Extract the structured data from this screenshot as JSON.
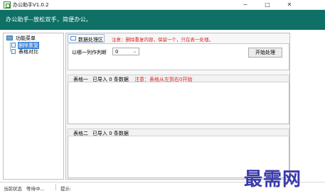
{
  "window": {
    "title": "办公助手V1.0.2",
    "minimize_glyph": "─",
    "maximize_glyph": "□",
    "close_glyph": "✕"
  },
  "banner": {
    "text": "办公助手--放松双手，简便办公。"
  },
  "sidebar": {
    "root_label": "功能菜单",
    "items": [
      {
        "label": "删除重复",
        "selected": true
      },
      {
        "label": "表格对比",
        "selected": false
      }
    ]
  },
  "main": {
    "tab_label": "数据处理区",
    "note": "注意：删除重复内容，保留一个，只在表一处理。",
    "sheet_label": "以哪一列作判断",
    "select_value": "0",
    "select_chevron": "⌄",
    "start_button": "开始处理"
  },
  "table1": {
    "name": "表格一",
    "count": "已导入 0 条数据",
    "note": "注意：表格从左到右0开始"
  },
  "table2": {
    "name": "表格二",
    "count": "已导入 0 条数据"
  },
  "status": {
    "state": "当前状态",
    "value": "等待中...",
    "hint": "提示:"
  },
  "watermark": {
    "text": "最需网"
  }
}
